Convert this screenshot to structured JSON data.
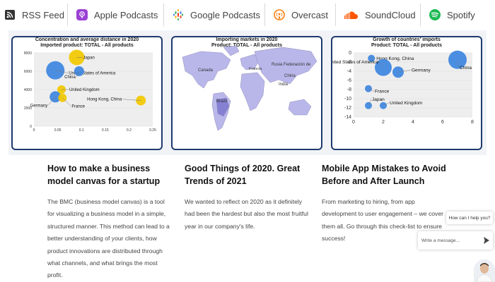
{
  "tabs": [
    {
      "label": "RSS Feed",
      "icon": "rss-icon",
      "color": "#333333"
    },
    {
      "label": "Apple Podcasts",
      "icon": "apple-podcasts-icon",
      "color": "#9b41d4"
    },
    {
      "label": "Google Podcasts",
      "icon": "google-podcasts-icon",
      "color": "#4285f4"
    },
    {
      "label": "Overcast",
      "icon": "overcast-icon",
      "color": "#fc7e0f"
    },
    {
      "label": "SoundCloud",
      "icon": "soundcloud-icon",
      "color": "#ff5500"
    },
    {
      "label": "Spotify",
      "icon": "spotify-icon",
      "color": "#1db954"
    }
  ],
  "chart_data": [
    {
      "type": "scatter",
      "title": "Concentration and average distance in 2020",
      "subtitle": "Imported product: TOTAL - All products",
      "xlim": [
        0,
        0.25
      ],
      "ylim": [
        0,
        8000
      ],
      "xticks": [
        "0",
        "0.05",
        "0.1",
        "0.15",
        "0.2",
        "0.25"
      ],
      "yticks": [
        "0",
        "2000",
        "4000",
        "6000",
        "8000"
      ],
      "points": [
        {
          "label": "Japan",
          "x": 0.09,
          "y": 7500,
          "color": "#f2c800"
        },
        {
          "label": "United States of America",
          "x": 0.045,
          "y": 6100,
          "color": "#3d85e0"
        },
        {
          "label": "China",
          "x": 0.095,
          "y": 6000,
          "color": "#3d85e0"
        },
        {
          "label": "United Kingdom",
          "x": 0.058,
          "y": 4000,
          "color": "#f2c800"
        },
        {
          "label": "Germany",
          "x": 0.045,
          "y": 3200,
          "color": "#3d85e0"
        },
        {
          "label": "France",
          "x": 0.06,
          "y": 3100,
          "color": "#f2c800"
        },
        {
          "label": "Hong Kong, China",
          "x": 0.225,
          "y": 2800,
          "color": "#f2c800"
        }
      ]
    },
    {
      "type": "map",
      "title": "Importing markets in 2020",
      "subtitle": "Product: TOTAL - All products",
      "labels": [
        "Canada",
        "Rusia Federación de",
        "Francia",
        "China",
        "India",
        "Brazil"
      ]
    },
    {
      "type": "scatter",
      "title": "Growth of countries' imports",
      "subtitle": "Product: TOTAL - All products",
      "xlim": [
        0,
        8
      ],
      "ylim": [
        -14,
        0
      ],
      "xticks": [
        "0",
        "2",
        "4",
        "6",
        "8"
      ],
      "yticks": [
        "0",
        "-2",
        "-4",
        "-6",
        "-8",
        "-10",
        "-12",
        "-14"
      ],
      "points": [
        {
          "label": "Hong Kong, China",
          "x": 1.2,
          "y": -1.2,
          "color": "#3d85e0"
        },
        {
          "label": "China",
          "x": 7.0,
          "y": -1.5,
          "color": "#3d85e0"
        },
        {
          "label": "United States of America",
          "x": 2.0,
          "y": -3.2,
          "color": "#3d85e0"
        },
        {
          "label": "Germany",
          "x": 3.0,
          "y": -4.2,
          "color": "#3d85e0"
        },
        {
          "label": "France",
          "x": 1.0,
          "y": -7.8,
          "color": "#3d85e0"
        },
        {
          "label": "Japan",
          "x": 1.0,
          "y": -11.5,
          "color": "#3d85e0"
        },
        {
          "label": "United Kingdom",
          "x": 2.0,
          "y": -11.5,
          "color": "#3d85e0"
        }
      ]
    }
  ],
  "articles": [
    {
      "title": "How to make a business model canvas for a startup",
      "body": "The BMC (business model canvas) is a tool for visualizing a business model in a simple, structured manner. This method can lead to a better understanding of your clients, how product innovations are distributed through what channels, and what brings the most profit."
    },
    {
      "title": "Good Things of 2020. Great Trends of 2021",
      "body": "We wanted to reflect on 2020 as it definitely had been the hardest but also the most fruitful year in our company's life."
    },
    {
      "title": "Mobile App Mistakes to Avoid Before and After Launch",
      "body": "From marketing to hiring, from app development to user engagement – we cover them all. Go through this check-list to ensure success!"
    }
  ],
  "chat": {
    "bubble": "How can I help you?",
    "placeholder": "Write a message..."
  }
}
